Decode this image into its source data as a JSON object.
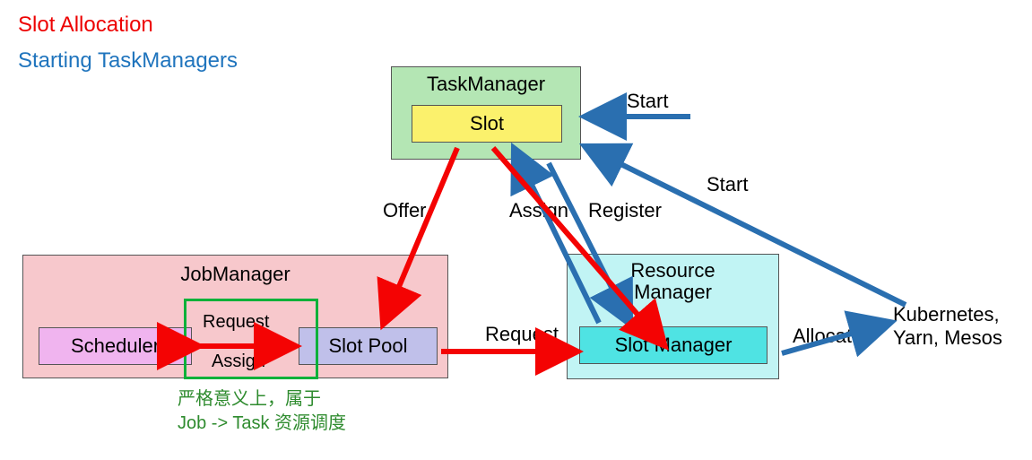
{
  "titles": {
    "slot_allocation": "Slot Allocation",
    "starting_tm": "Starting TaskManagers"
  },
  "nodes": {
    "task_manager": "TaskManager",
    "slot": "Slot",
    "job_manager": "JobManager",
    "scheduler": "Scheduler",
    "slot_pool": "Slot Pool",
    "resource_manager_l1": "Resource",
    "resource_manager_l2": "Manager",
    "slot_manager": "Slot Manager",
    "external": "Kubernetes,\nYarn, Mesos"
  },
  "edges": {
    "start_tm": "Start",
    "start_rm": "Start",
    "offer": "Offer",
    "assign_slot": "Assign",
    "register": "Register",
    "request_sp": "Request",
    "assign_sp": "Assign",
    "request_rm": "Request",
    "allocate": "Allocate"
  },
  "note": {
    "line1": "严格意义上，属于",
    "line2": "Job -> Task 资源调度"
  },
  "colors": {
    "red": "#f40303",
    "blue": "#2a6fb0",
    "green_stroke": "#0bb13a"
  }
}
